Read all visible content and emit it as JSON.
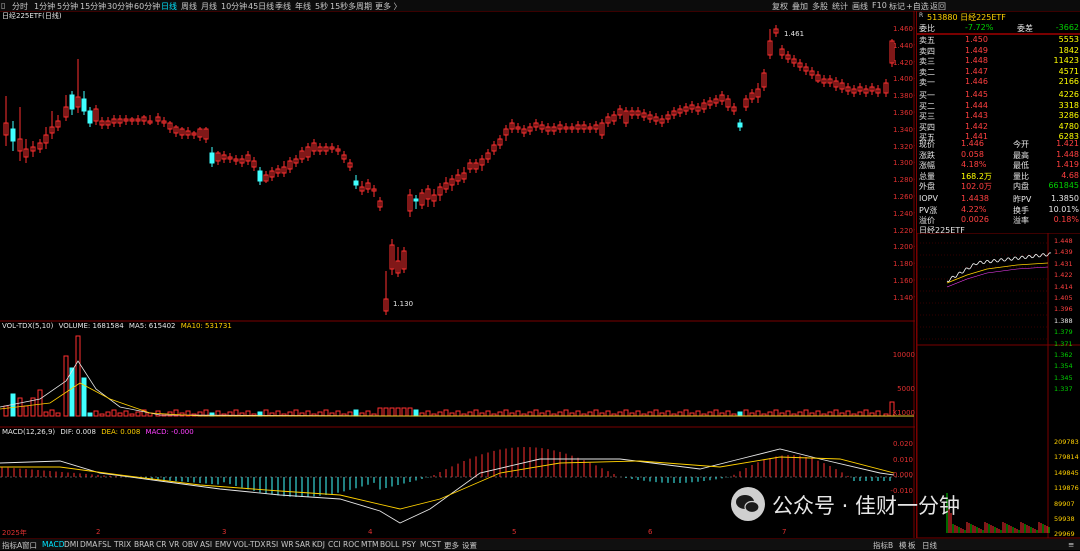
{
  "toolbar": {
    "left_label": "▯",
    "periods": [
      "分时",
      "1分钟",
      "5分钟",
      "15分钟",
      "30分钟",
      "60分钟",
      "日线",
      "周线",
      "月线",
      "10分钟",
      "45日线",
      "季线",
      "年线",
      "5秒",
      "15秒",
      "多周期",
      "更多 〉"
    ],
    "active_period": "日线",
    "tools": [
      "复权",
      "叠加",
      "多股",
      "统计",
      "画线",
      "F10",
      "标记",
      "+自选",
      "返回"
    ]
  },
  "chart": {
    "title": "日经225ETF(日线)",
    "price_ticks": [
      "1.460",
      "1.440",
      "1.420",
      "1.400",
      "1.380",
      "1.360",
      "1.340",
      "1.320",
      "1.300",
      "1.280",
      "1.260",
      "1.240",
      "1.220",
      "1.200",
      "1.180",
      "1.160",
      "1.140"
    ],
    "high_label": "1.461",
    "low_label": "1.130",
    "volume_title": "VOL-TDX(5,10)",
    "volume_value": "VOLUME: 1681584",
    "ma5_value": "MA5: 615402",
    "ma10_value": "MA10: 531731",
    "volume_ticks": [
      "10000",
      "5000"
    ],
    "volume_unit": "X1000",
    "macd_title": "MACD(12,26,9)",
    "dif_value": "DIF: 0.008",
    "dea_value": "DEA: 0.008",
    "macd_value": "MACD: -0.000",
    "macd_ticks": [
      "0.020",
      "0.010",
      "0.000",
      "-0.010"
    ],
    "date_labels": [
      "2025年",
      "2",
      "3",
      "4",
      "5",
      "6",
      "7"
    ],
    "colors": {
      "up": "#ff3030",
      "down": "#40ffff",
      "ma": "#e6e6e6",
      "ma2": "#ffd000",
      "grid": "#7a0000"
    }
  },
  "quote": {
    "code_badge": "R",
    "code_name": "513880 日经225ETF",
    "weibi_label": "委比",
    "weibi_value": "-7.72%",
    "weicha_label": "委差",
    "weicha_value": "-3662",
    "asks": [
      {
        "label": "卖五",
        "price": "1.450",
        "vol": "5553"
      },
      {
        "label": "卖四",
        "price": "1.449",
        "vol": "1842"
      },
      {
        "label": "卖三",
        "price": "1.448",
        "vol": "11423"
      },
      {
        "label": "卖二",
        "price": "1.447",
        "vol": "4571"
      },
      {
        "label": "卖一",
        "price": "1.446",
        "vol": "2166"
      }
    ],
    "bids": [
      {
        "label": "买一",
        "price": "1.445",
        "vol": "4226"
      },
      {
        "label": "买二",
        "price": "1.444",
        "vol": "3318"
      },
      {
        "label": "买三",
        "price": "1.443",
        "vol": "3286"
      },
      {
        "label": "买四",
        "price": "1.442",
        "vol": "4780"
      },
      {
        "label": "买五",
        "price": "1.441",
        "vol": "6283"
      }
    ],
    "stats": [
      {
        "l1": "现价",
        "v1": "1.446",
        "l2": "今开",
        "v2": "1.421",
        "c1": "red",
        "c2": "red"
      },
      {
        "l1": "涨跌",
        "v1": "0.058",
        "l2": "最高",
        "v2": "1.448",
        "c1": "red",
        "c2": "red"
      },
      {
        "l1": "涨幅",
        "v1": "4.18%",
        "l2": "最低",
        "v2": "1.419",
        "c1": "red",
        "c2": "red"
      },
      {
        "l1": "总量",
        "v1": "168.2万",
        "l2": "量比",
        "v2": "4.68",
        "c1": "yellow",
        "c2": "red"
      },
      {
        "l1": "外盘",
        "v1": "102.0万",
        "l2": "内盘",
        "v2": "661845",
        "c1": "red",
        "c2": "green"
      },
      {
        "l1": "IOPV",
        "v1": "1.4438",
        "l2": "昨PV",
        "v2": "1.3850",
        "c1": "red",
        "c2": "white"
      },
      {
        "l1": "PV涨",
        "v1": "4.22%",
        "l2": "换手",
        "v2": "10.01%",
        "c1": "red",
        "c2": "white"
      },
      {
        "l1": "溢价",
        "v1": "0.0026",
        "l2": "溢率",
        "v2": "0.18%",
        "c1": "red",
        "c2": "red"
      }
    ]
  },
  "mini_chart": {
    "title": "日经225ETF",
    "ticks": [
      "1.448",
      "1.439",
      "1.431",
      "1.422",
      "1.414",
      "1.405",
      "1.396",
      "1.388",
      "1.379",
      "1.371",
      "1.362",
      "1.354",
      "1.345",
      "1.337"
    ],
    "vol_ticks": [
      "209783",
      "179814",
      "149845",
      "119876",
      "89907",
      "59938",
      "29969"
    ]
  },
  "bottom": {
    "left_items": [
      "指标A",
      "窗口"
    ],
    "indicators": [
      "MACD",
      "DMI",
      "DMA",
      "FSL",
      "TRIX",
      "BRAR",
      "CR",
      "VR",
      "OBV",
      "ASI",
      "EMV",
      "VOL-TDX",
      "RSI",
      "WR",
      "SAR",
      "KDJ",
      "CCI",
      "ROC",
      "MTM",
      "BOLL",
      "PSY",
      "MCST",
      "更多",
      "设置"
    ],
    "active_indicator": "MACD",
    "right_items": [
      "指标B",
      "模",
      "板"
    ],
    "panel_tabs": [
      "日线",
      "≡"
    ]
  },
  "watermark": {
    "text": "公众号 · 佳财一分钟"
  }
}
